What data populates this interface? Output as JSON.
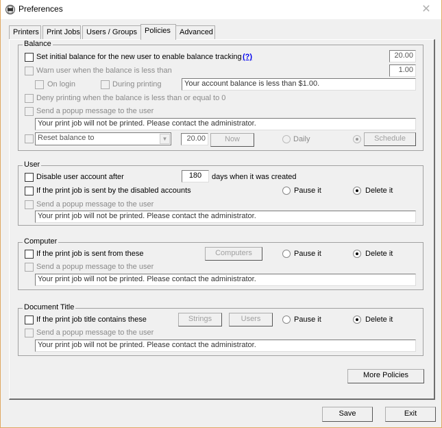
{
  "window": {
    "title": "Preferences",
    "icon": "printer-app-icon",
    "close_icon": "close-icon"
  },
  "tabs": [
    {
      "label": "Printers",
      "active": false
    },
    {
      "label": "Print Jobs",
      "active": false
    },
    {
      "label": "Users / Groups",
      "active": false
    },
    {
      "label": "Policies",
      "active": true
    },
    {
      "label": "Advanced",
      "active": false
    }
  ],
  "balance": {
    "group_label": "Balance",
    "set_initial": {
      "label": "Set initial balance for the new user to enable balance tracking",
      "checked": false,
      "help_link": "(?)",
      "value": "20.00"
    },
    "warn_user": {
      "label": "Warn user when the balance is less than",
      "checked": false,
      "enabled": false,
      "value": "1.00"
    },
    "on_login": {
      "label": "On login",
      "checked": false,
      "enabled": false
    },
    "during_printing": {
      "label": "During printing",
      "checked": false,
      "enabled": false
    },
    "warn_message": "Your account balance is less than $1.00.",
    "deny_printing": {
      "label": "Deny printing when the balance is less than or equal to 0",
      "checked": false,
      "enabled": false
    },
    "send_popup": {
      "label": "Send a popup message to the user",
      "checked": false,
      "enabled": false
    },
    "popup_message": "Your print job will not be printed. Please contact the administrator.",
    "reset": {
      "checked": false,
      "select_value": "Reset balance to",
      "amount": "20.00",
      "now_label": "Now",
      "daily_label": "Daily",
      "daily_selected": false,
      "schedule_selected": true,
      "schedule_label": "Schedule"
    }
  },
  "user": {
    "group_label": "User",
    "disable_account": {
      "label": "Disable user account after",
      "checked": false,
      "days": "180",
      "suffix": "days when it was created"
    },
    "disabled_sent": {
      "label": "If the print job is sent by the disabled accounts",
      "checked": false
    },
    "pause_label": "Pause it",
    "delete_label": "Delete it",
    "action": "delete",
    "send_popup": {
      "label": "Send a popup message to the user",
      "checked": false,
      "enabled": false
    },
    "popup_message": "Your print job will not be printed. Please contact the administrator."
  },
  "computer": {
    "group_label": "Computer",
    "sent_from": {
      "label": "If the print job is sent from these",
      "checked": false
    },
    "computers_button": "Computers",
    "pause_label": "Pause it",
    "delete_label": "Delete it",
    "action": "delete",
    "send_popup": {
      "label": "Send a popup message to the user",
      "checked": false,
      "enabled": false
    },
    "popup_message": "Your print job will not be printed. Please contact the administrator."
  },
  "document_title": {
    "group_label": "Document Title",
    "title_contains": {
      "label": "If the print job title contains these",
      "checked": false
    },
    "strings_button": "Strings",
    "users_button": "Users",
    "pause_label": "Pause it",
    "delete_label": "Delete it",
    "action": "delete",
    "send_popup": {
      "label": "Send a popup message to the user",
      "checked": false,
      "enabled": false
    },
    "popup_message": "Your print job will not be printed. Please contact the administrator."
  },
  "buttons": {
    "more_policies": "More Policies",
    "save": "Save",
    "exit": "Exit"
  }
}
